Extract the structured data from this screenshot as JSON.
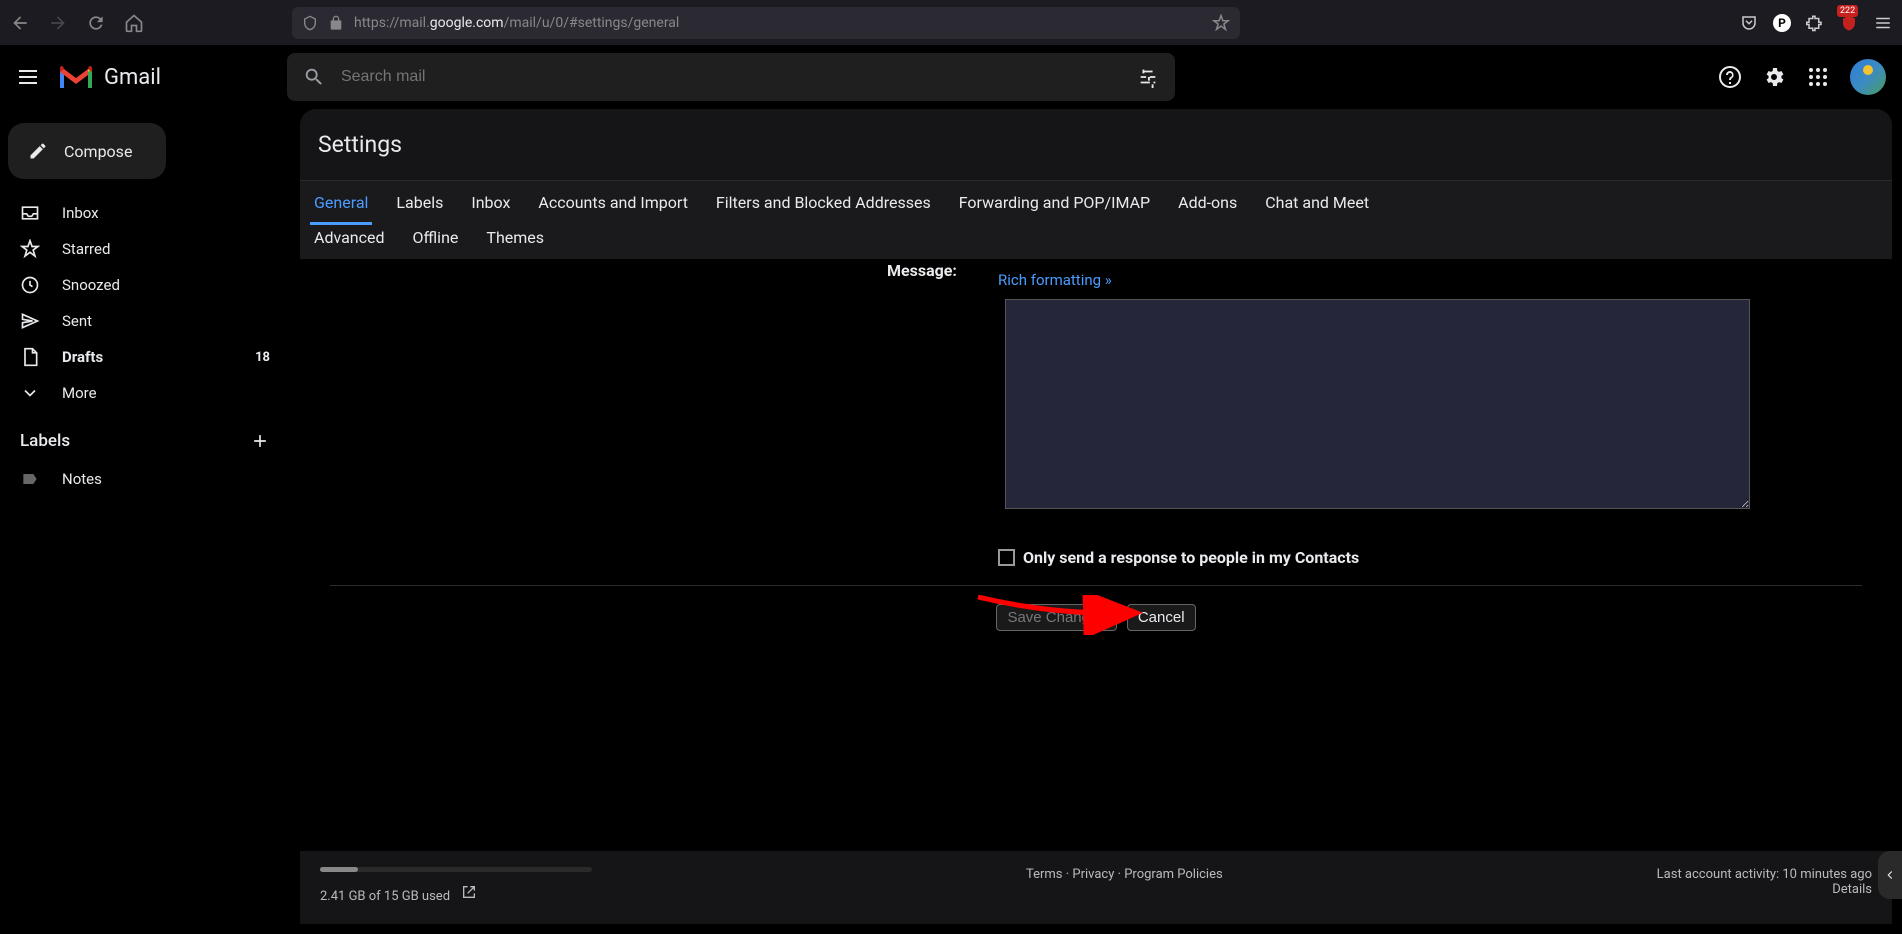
{
  "browser": {
    "url_prefix": "https://mail.",
    "url_domain": "google.com",
    "url_suffix": "/mail/u/0/#settings/general",
    "ext_count": "222"
  },
  "header": {
    "app_name": "Gmail",
    "search_placeholder": "Search mail"
  },
  "sidebar": {
    "compose": "Compose",
    "items": [
      {
        "label": "Inbox",
        "icon": "inbox"
      },
      {
        "label": "Starred",
        "icon": "star"
      },
      {
        "label": "Snoozed",
        "icon": "clock"
      },
      {
        "label": "Sent",
        "icon": "send"
      },
      {
        "label": "Drafts",
        "icon": "file",
        "count": "18",
        "bold": true
      },
      {
        "label": "More",
        "icon": "chevron-down"
      }
    ],
    "labels_header": "Labels",
    "labels": [
      {
        "label": "Notes"
      }
    ]
  },
  "settings": {
    "title": "Settings",
    "tabs_row1": [
      "General",
      "Labels",
      "Inbox",
      "Accounts and Import",
      "Filters and Blocked Addresses",
      "Forwarding and POP/IMAP",
      "Add-ons",
      "Chat and Meet"
    ],
    "tabs_row2": [
      "Advanced",
      "Offline",
      "Themes"
    ],
    "active_tab": "General",
    "message_label": "Message:",
    "rich_formatting": "Rich formatting »",
    "contacts_checkbox": "Only send a response to people in my Contacts",
    "save_btn": "Save Changes",
    "cancel_btn": "Cancel"
  },
  "footer": {
    "storage": "2.41 GB of 15 GB used",
    "terms": "Terms",
    "privacy": "Privacy",
    "policies": "Program Policies",
    "activity": "Last account activity: 10 minutes ago",
    "details": "Details"
  }
}
